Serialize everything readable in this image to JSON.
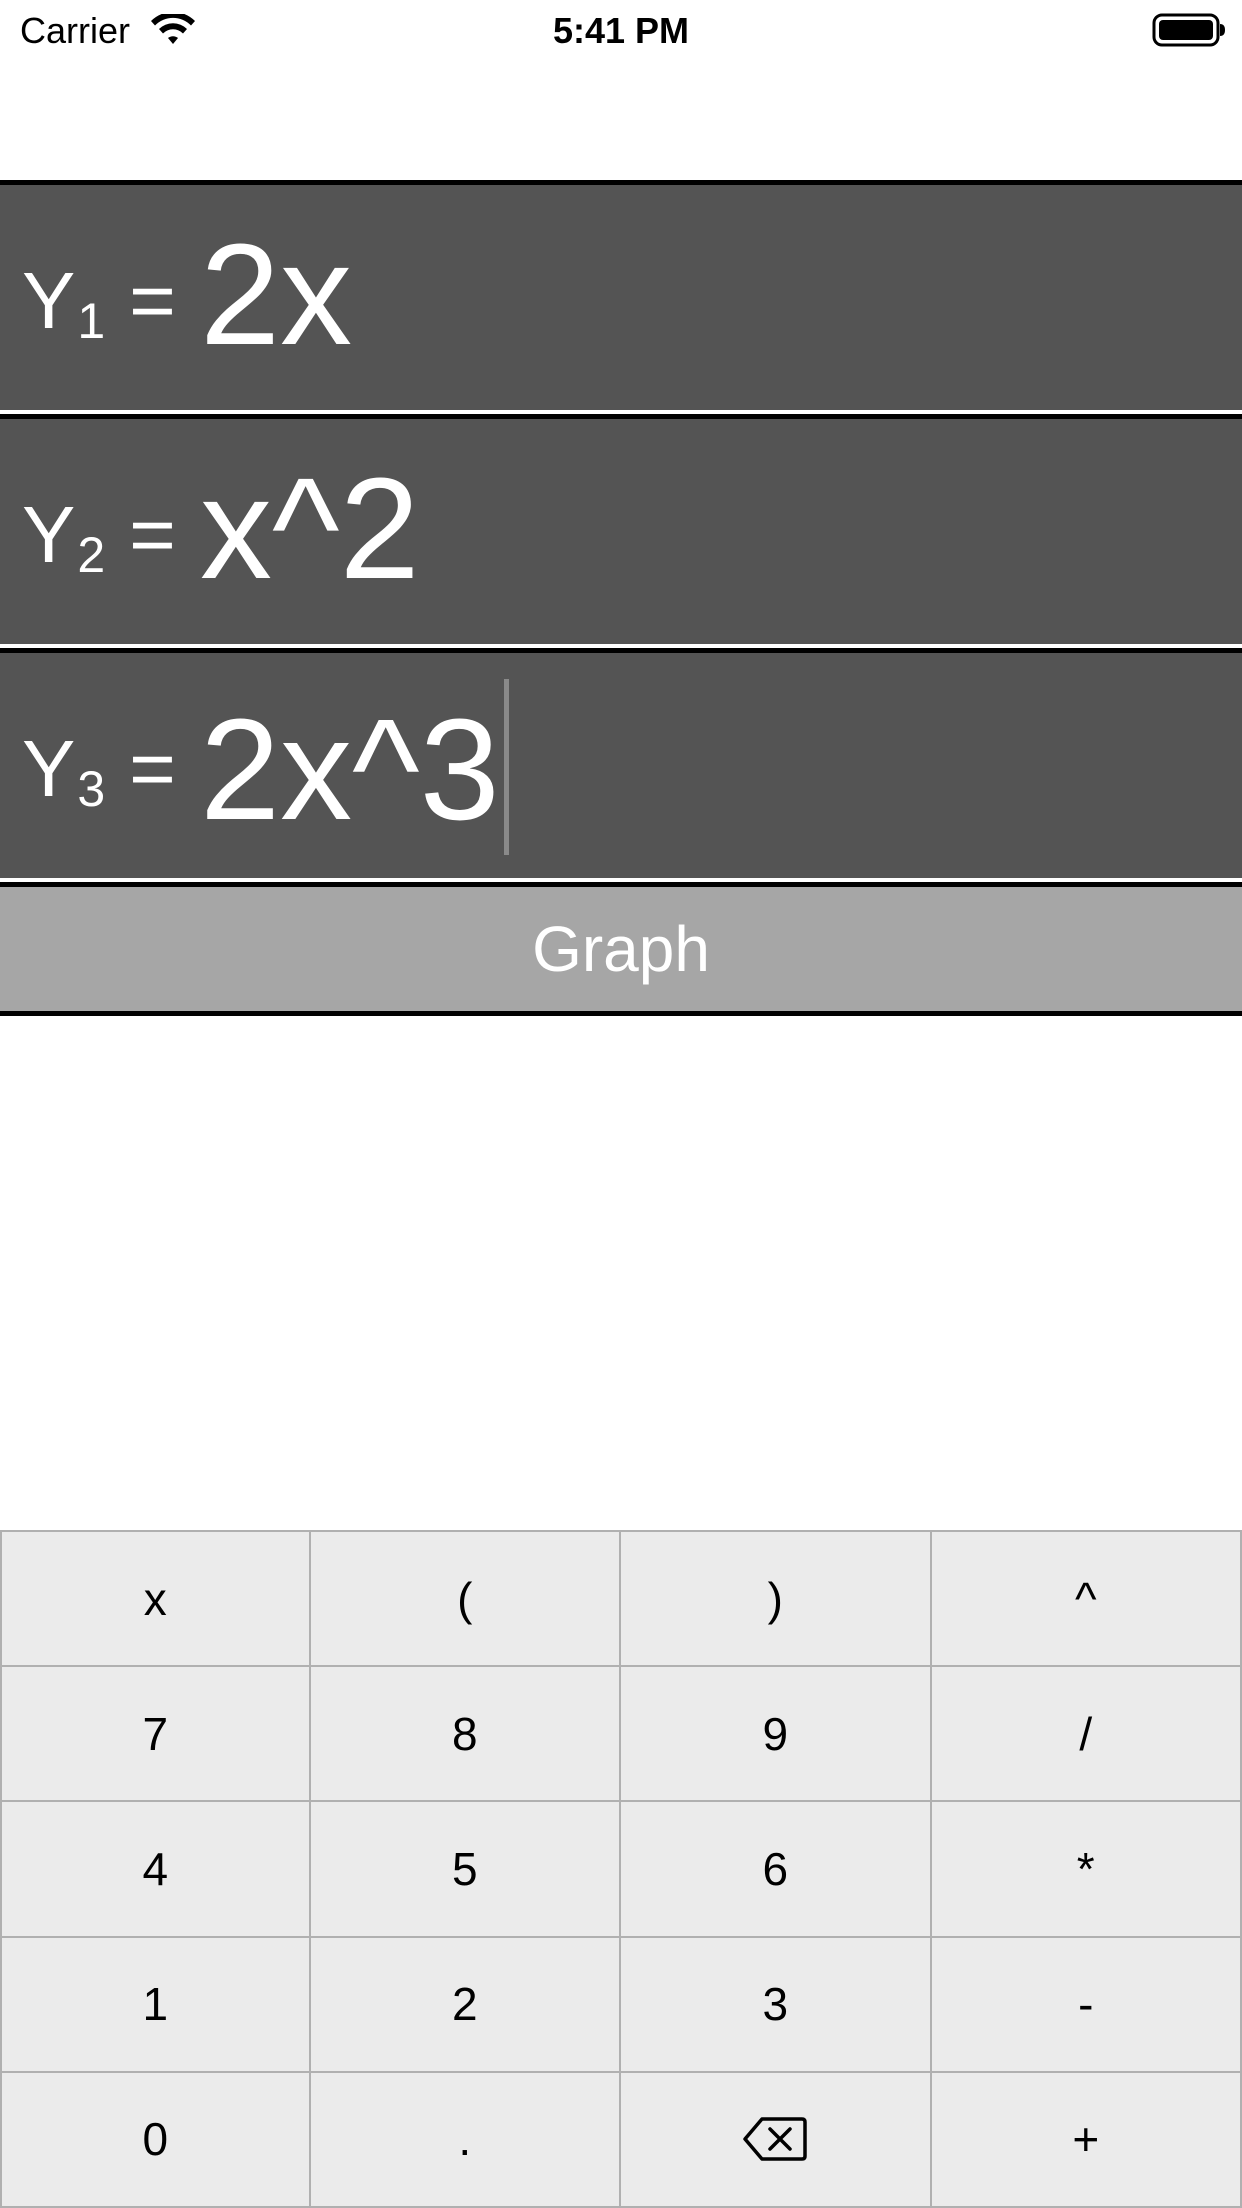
{
  "status_bar": {
    "carrier": "Carrier",
    "time": "5:41 PM",
    "wifi_icon": "wifi-icon",
    "battery_icon": "battery-full-icon"
  },
  "equations": [
    {
      "label": "Y",
      "subscript": "1",
      "equals": "=",
      "value": "2x"
    },
    {
      "label": "Y",
      "subscript": "2",
      "equals": "=",
      "value": "x^2"
    },
    {
      "label": "Y",
      "subscript": "3",
      "equals": "=",
      "value": "2x^3"
    }
  ],
  "graph_button": {
    "label": "Graph"
  },
  "keypad": {
    "keys": [
      {
        "label": "x"
      },
      {
        "label": "("
      },
      {
        "label": ")"
      },
      {
        "label": "^"
      },
      {
        "label": "7"
      },
      {
        "label": "8"
      },
      {
        "label": "9"
      },
      {
        "label": "/"
      },
      {
        "label": "4"
      },
      {
        "label": "5"
      },
      {
        "label": "6"
      },
      {
        "label": "*"
      },
      {
        "label": "1"
      },
      {
        "label": "2"
      },
      {
        "label": "3"
      },
      {
        "label": "-"
      },
      {
        "label": "0"
      },
      {
        "label": "."
      },
      {
        "label": "",
        "icon": "backspace-icon"
      },
      {
        "label": "+"
      }
    ]
  },
  "colors": {
    "row_background": "#545454",
    "graph_button_background": "#a6a6a6",
    "keypad_background": "#ebebeb"
  }
}
